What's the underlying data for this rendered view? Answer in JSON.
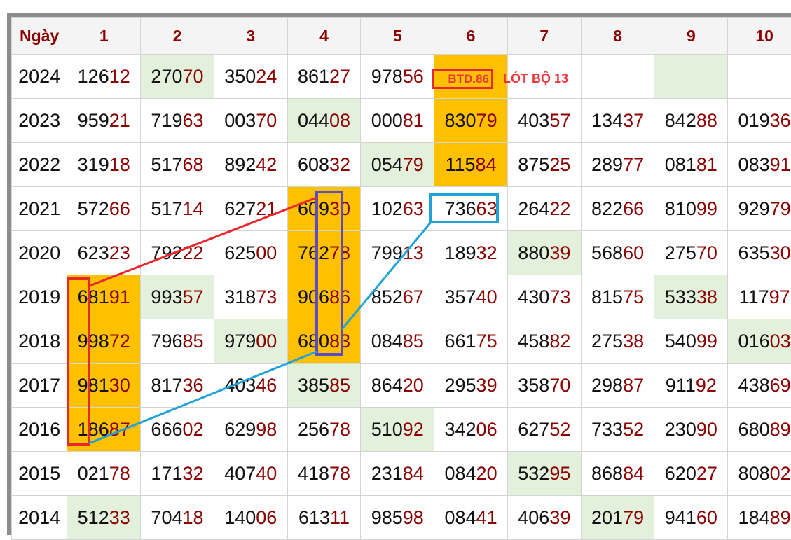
{
  "header": {
    "day_label": "Ngày",
    "columns": [
      "1",
      "2",
      "3",
      "4",
      "5",
      "6",
      "7",
      "8",
      "9",
      "10"
    ]
  },
  "rows": [
    {
      "year": "2024",
      "cells": [
        [
          "126",
          "12"
        ],
        [
          "270",
          "70"
        ],
        [
          "350",
          "24"
        ],
        [
          "861",
          "27"
        ],
        [
          "978",
          "56"
        ],
        [
          "",
          ""
        ],
        [
          "",
          ""
        ],
        [
          "",
          ""
        ],
        [
          "",
          ""
        ],
        [
          "",
          ""
        ]
      ]
    },
    {
      "year": "2023",
      "cells": [
        [
          "959",
          "21"
        ],
        [
          "719",
          "63"
        ],
        [
          "003",
          "70"
        ],
        [
          "044",
          "08"
        ],
        [
          "000",
          "81"
        ],
        [
          "830",
          "79"
        ],
        [
          "403",
          "57"
        ],
        [
          "134",
          "37"
        ],
        [
          "842",
          "88"
        ],
        [
          "019",
          "36"
        ]
      ]
    },
    {
      "year": "2022",
      "cells": [
        [
          "319",
          "18"
        ],
        [
          "517",
          "68"
        ],
        [
          "892",
          "42"
        ],
        [
          "608",
          "32"
        ],
        [
          "054",
          "79"
        ],
        [
          "115",
          "84"
        ],
        [
          "875",
          "25"
        ],
        [
          "289",
          "77"
        ],
        [
          "081",
          "81"
        ],
        [
          "083",
          "91"
        ]
      ]
    },
    {
      "year": "2021",
      "cells": [
        [
          "572",
          "66"
        ],
        [
          "517",
          "14"
        ],
        [
          "627",
          "21"
        ],
        [
          "609",
          "30"
        ],
        [
          "102",
          "63"
        ],
        [
          "736",
          "63"
        ],
        [
          "264",
          "22"
        ],
        [
          "822",
          "66"
        ],
        [
          "810",
          "99"
        ],
        [
          "929",
          "79"
        ]
      ]
    },
    {
      "year": "2020",
      "cells": [
        [
          "623",
          "23"
        ],
        [
          "792",
          "22"
        ],
        [
          "625",
          "00"
        ],
        [
          "762",
          "78"
        ],
        [
          "799",
          "13"
        ],
        [
          "189",
          "32"
        ],
        [
          "880",
          "39"
        ],
        [
          "568",
          "60"
        ],
        [
          "275",
          "70"
        ],
        [
          "635",
          "30"
        ]
      ]
    },
    {
      "year": "2019",
      "cells": [
        [
          "681",
          "91"
        ],
        [
          "993",
          "57"
        ],
        [
          "318",
          "73"
        ],
        [
          "906",
          "86"
        ],
        [
          "852",
          "67"
        ],
        [
          "357",
          "40"
        ],
        [
          "430",
          "73"
        ],
        [
          "815",
          "75"
        ],
        [
          "533",
          "38"
        ],
        [
          "117",
          "97"
        ]
      ]
    },
    {
      "year": "2018",
      "cells": [
        [
          "998",
          "72"
        ],
        [
          "796",
          "85"
        ],
        [
          "979",
          "00"
        ],
        [
          "680",
          "83"
        ],
        [
          "084",
          "85"
        ],
        [
          "661",
          "75"
        ],
        [
          "458",
          "82"
        ],
        [
          "275",
          "38"
        ],
        [
          "540",
          "99"
        ],
        [
          "016",
          "03"
        ]
      ]
    },
    {
      "year": "2017",
      "cells": [
        [
          "981",
          "30"
        ],
        [
          "817",
          "36"
        ],
        [
          "403",
          "46"
        ],
        [
          "385",
          "85"
        ],
        [
          "864",
          "20"
        ],
        [
          "295",
          "39"
        ],
        [
          "358",
          "70"
        ],
        [
          "298",
          "87"
        ],
        [
          "911",
          "92"
        ],
        [
          "438",
          "69"
        ]
      ]
    },
    {
      "year": "2016",
      "cells": [
        [
          "186",
          "87"
        ],
        [
          "666",
          "02"
        ],
        [
          "629",
          "98"
        ],
        [
          "256",
          "78"
        ],
        [
          "510",
          "92"
        ],
        [
          "342",
          "06"
        ],
        [
          "627",
          "52"
        ],
        [
          "733",
          "52"
        ],
        [
          "230",
          "90"
        ],
        [
          "680",
          "89"
        ]
      ]
    },
    {
      "year": "2015",
      "cells": [
        [
          "021",
          "78"
        ],
        [
          "171",
          "32"
        ],
        [
          "407",
          "40"
        ],
        [
          "418",
          "78"
        ],
        [
          "231",
          "84"
        ],
        [
          "084",
          "20"
        ],
        [
          "532",
          "95"
        ],
        [
          "868",
          "84"
        ],
        [
          "620",
          "27"
        ],
        [
          "808",
          "02"
        ]
      ]
    },
    {
      "year": "2014",
      "cells": [
        [
          "512",
          "33"
        ],
        [
          "704",
          "18"
        ],
        [
          "140",
          "06"
        ],
        [
          "613",
          "11"
        ],
        [
          "985",
          "98"
        ],
        [
          "084",
          "41"
        ],
        [
          "406",
          "39"
        ],
        [
          "201",
          "79"
        ],
        [
          "941",
          "60"
        ],
        [
          "184",
          "89"
        ]
      ]
    }
  ],
  "annotation": {
    "btd_label": "BTD.86",
    "note": "LÓT BỘ 13"
  },
  "colors": {
    "highlight_orange": "#ffc000",
    "highlight_green": "#e3f1dc",
    "line_red": "#e8282d",
    "line_blue": "#1fa2d8",
    "box_purple": "#5c4bc4"
  }
}
